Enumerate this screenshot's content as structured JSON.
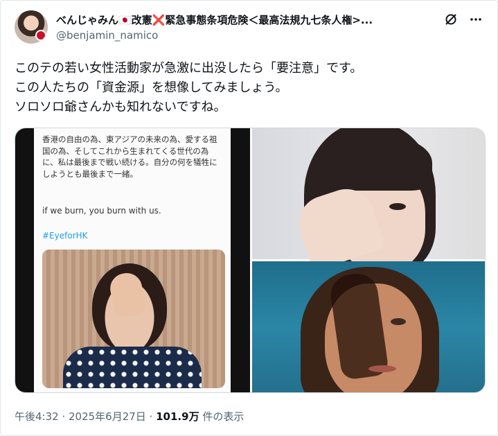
{
  "author": {
    "display_name": "べんじゃみん🇯🇵改憲❌緊急事態条項危険＜最高法規九七条人権>...",
    "handle": "@benjamin_namico"
  },
  "tweet": {
    "lines": [
      "このテの若い女性活動家が急激に出没したら「要注意」です。",
      "この人たちの「資金源」を想像してみましょう。",
      "ソロソロ爺さんかも知れないですね。"
    ]
  },
  "media": {
    "screenshot_text": "香港の自由の為、東アジアの未来の為、愛する祖国の為、そしてこれから生まれてくる世代の為に、私は最後まで戦い続ける。自分の何を犠牲にしようとも最後まで一緒。",
    "screenshot_english": "if we burn, you burn with us.",
    "screenshot_hashtag": "#EyeforHK"
  },
  "meta": {
    "time": "午後4:32",
    "sep1": " · ",
    "date": "2025年6月27日",
    "sep2": " · ",
    "views": "101.9万",
    "views_suffix": " 件の表示"
  },
  "icons": {
    "grok": "grok-icon",
    "more": "more-icon"
  }
}
